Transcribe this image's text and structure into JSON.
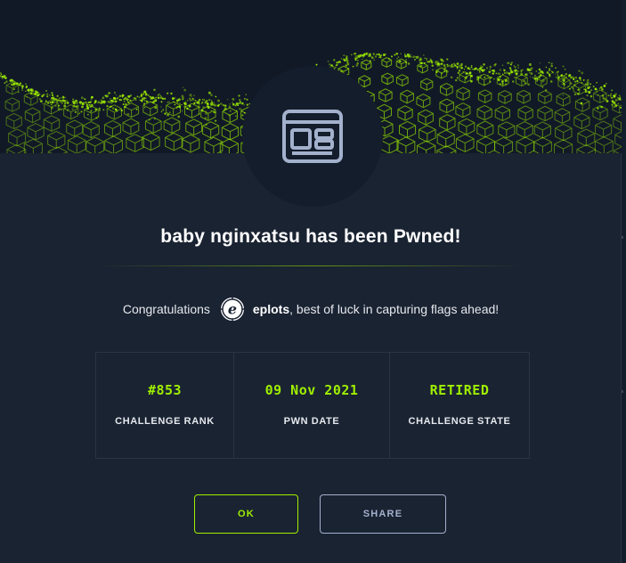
{
  "modal": {
    "title": "baby nginxatsu has been Pwned!",
    "challenge_icon": "browser-window-icon",
    "congrats": {
      "prefix": "Congratulations",
      "avatar_icon": "user-avatar-e-icon",
      "username": "eplots",
      "suffix": ", best of luck in capturing flags ahead!"
    },
    "stats": [
      {
        "value": "#853",
        "label": "CHALLENGE RANK"
      },
      {
        "value": "09 Nov 2021",
        "label": "PWN DATE"
      },
      {
        "value": "RETIRED",
        "label": "CHALLENGE STATE"
      }
    ],
    "buttons": {
      "ok": "OK",
      "share": "SHARE"
    }
  },
  "colors": {
    "accent": "#9fef00",
    "background": "#1a2332",
    "banner": "#111927",
    "border": "#2a3445",
    "secondary_text": "#a4b1cd"
  }
}
